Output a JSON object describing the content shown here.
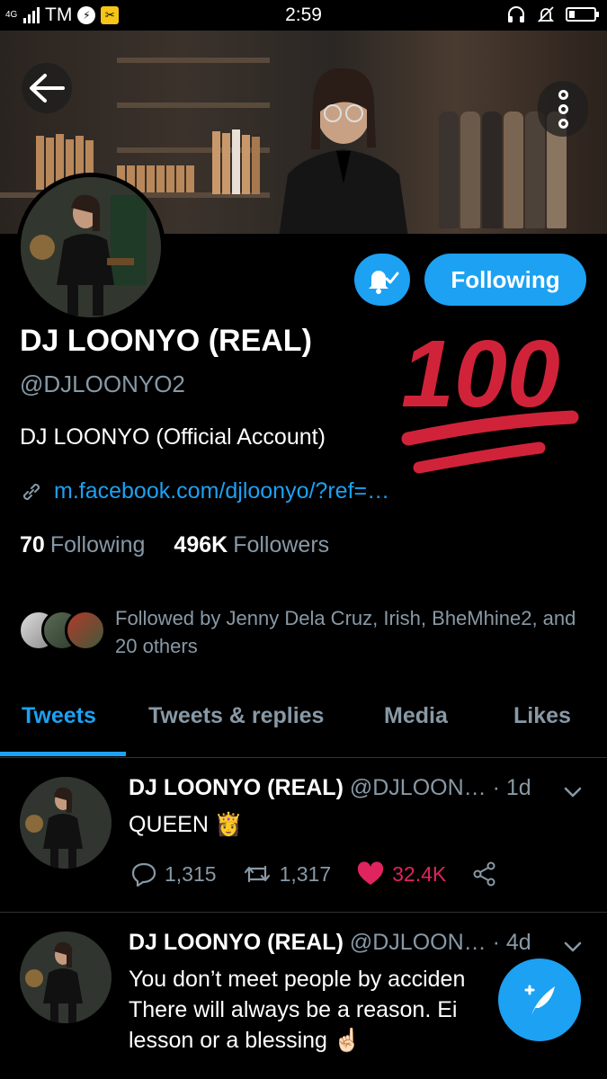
{
  "status_bar": {
    "network": "4G",
    "carrier": "TM",
    "time": "2:59",
    "battery_level": 0.2,
    "icons": [
      "signal-icon",
      "messenger-icon",
      "app-notification-icon",
      "headphones-icon",
      "mute-icon",
      "battery-icon"
    ]
  },
  "header": {
    "back_icon": "arrow-left-icon",
    "more_icon": "more-vertical-icon"
  },
  "profile": {
    "display_name": "DJ LOONYO (REAL)",
    "handle": "@DJLOONYO2",
    "bio": "DJ LOONYO (Official Account)",
    "link": "m.facebook.com/djloonyo/?ref=…",
    "following_count": "70",
    "following_label": "Following",
    "followers_count": "496K",
    "followers_label": "Followers",
    "follow_button_label": "Following",
    "notification_icon": "bell-check-icon",
    "sticker": "100",
    "followed_by_text": "Followed by Jenny Dela Cruz, Irish, BheMhine2, and 20 others"
  },
  "tabs": [
    {
      "label": "Tweets",
      "active": true
    },
    {
      "label": "Tweets & replies",
      "active": false
    },
    {
      "label": "Media",
      "active": false
    },
    {
      "label": "Likes",
      "active": false
    }
  ],
  "tweets": [
    {
      "name": "DJ LOONYO (REAL)",
      "handle": "@DJLOON…",
      "time": "· 1d",
      "text": "QUEEN 👸",
      "replies": "1,315",
      "retweets": "1,317",
      "likes": "32.4K",
      "liked": true
    },
    {
      "name": "DJ LOONYO (REAL)",
      "handle": "@DJLOON…",
      "time": "· 4d",
      "text_lines": [
        "You don’t meet people by acciden",
        "There will always be a reason. Ei",
        "lesson or a blessing ☝🏻"
      ]
    }
  ],
  "colors": {
    "accent": "#1da1f2",
    "like": "#e0245e",
    "muted": "#8899a6",
    "background": "#000000",
    "sticker": "#d0233a"
  },
  "fab_icon": "compose-tweet-icon"
}
